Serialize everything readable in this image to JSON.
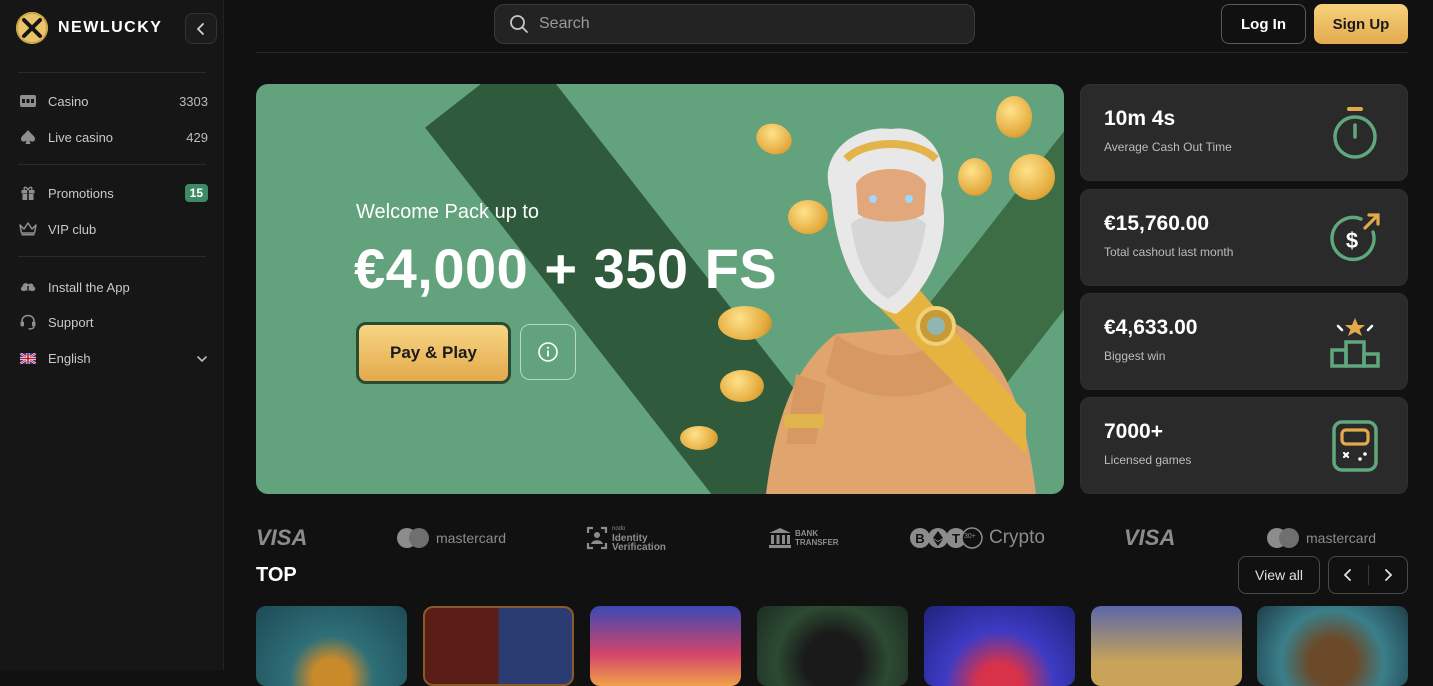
{
  "brand": {
    "name": "NEWLUCKY"
  },
  "sidebar": {
    "items": [
      {
        "label": "Casino",
        "count": "3303"
      },
      {
        "label": "Live casino",
        "count": "429"
      },
      {
        "label": "Promotions",
        "badge": "15"
      },
      {
        "label": "VIP club"
      },
      {
        "label": "Install the App"
      },
      {
        "label": "Support"
      },
      {
        "label": "English"
      }
    ]
  },
  "header": {
    "search_placeholder": "Search",
    "login_label": "Log In",
    "signup_label": "Sign Up"
  },
  "hero": {
    "subtitle": "Welcome Pack up to",
    "title": "€4,000 + 350 FS",
    "cta_label": "Pay & Play"
  },
  "stats": [
    {
      "value": "10m 4s",
      "label": "Average Cash Out Time",
      "icon": "stopwatch-icon"
    },
    {
      "value": "€15,760.00",
      "label": "Total cashout last month",
      "icon": "dollar-cycle-icon"
    },
    {
      "value": "€4,633.00",
      "label": "Biggest win",
      "icon": "podium-icon"
    },
    {
      "value": "7000+",
      "label": "Licensed games",
      "icon": "slot-machine-icon"
    }
  ],
  "payments": {
    "visa": "VISA",
    "mastercard": "mastercard",
    "identity_small": "nodo",
    "identity": "Identity",
    "verification": "Verification",
    "bank_1": "BANK",
    "bank_2": "TRANSFER",
    "crypto": "Crypto",
    "crypto_more": "30+"
  },
  "top": {
    "heading": "TOP",
    "view_all_label": "View all"
  },
  "colors": {
    "accent_gold": "#e9b95a",
    "hero_green": "#62a27c",
    "badge_green": "#3f8a66",
    "icon_green": "#5fa77c"
  }
}
